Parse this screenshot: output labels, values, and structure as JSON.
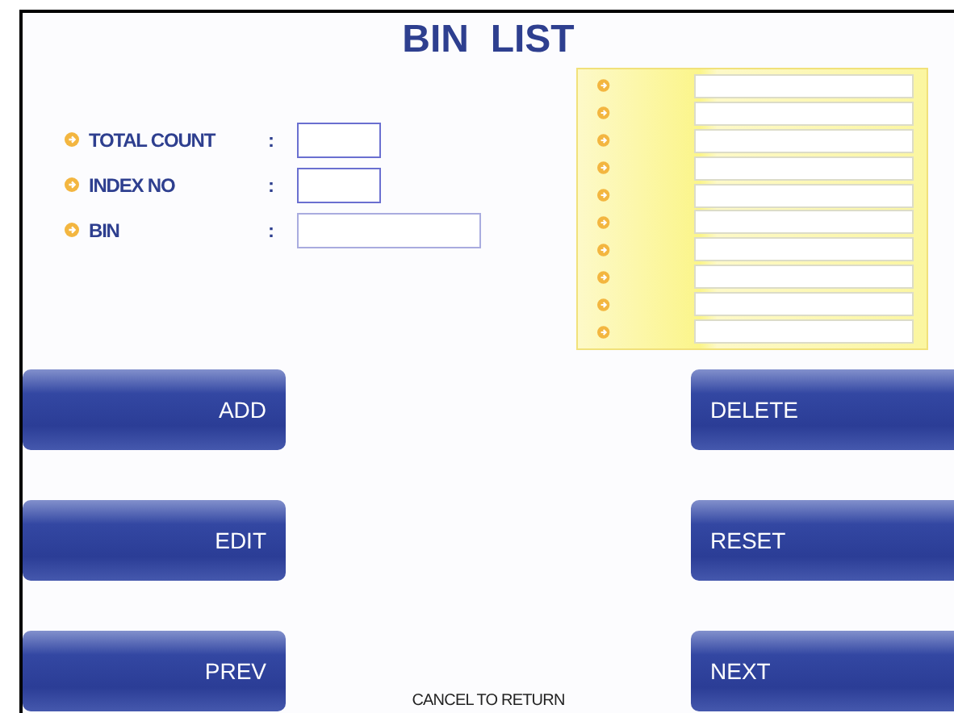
{
  "title": "BIN  LIST",
  "fields": [
    {
      "label": "TOTAL COUNT",
      "separator": ":"
    },
    {
      "label": "INDEX NO",
      "separator": ":"
    },
    {
      "label": "BIN",
      "separator": ":"
    }
  ],
  "buttons_left": [
    "ADD",
    "EDIT",
    "PREV"
  ],
  "buttons_right": [
    "DELETE",
    "RESET",
    "NEXT"
  ],
  "footer": "CANCEL TO RETURN"
}
